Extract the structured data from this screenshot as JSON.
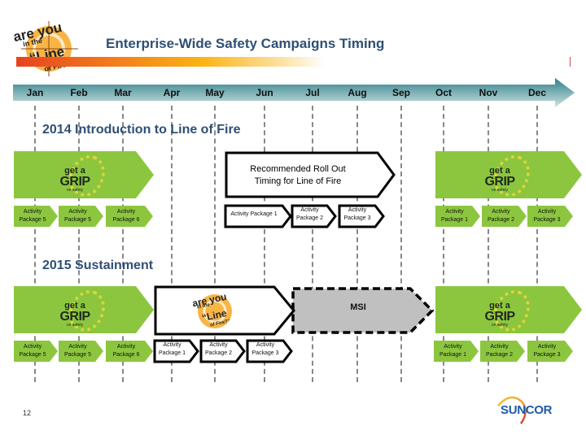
{
  "header": {
    "title": "Enterprise-Wide Safety Campaigns Timing",
    "logo_lines": [
      "are you",
      "in the",
      "“Line",
      "of Fire?”"
    ]
  },
  "timeline": {
    "months": [
      "Jan",
      "Feb",
      "Mar",
      "Apr",
      "May",
      "Jun",
      "Jul",
      "Aug",
      "Sep",
      "Oct",
      "Nov",
      "Dec"
    ]
  },
  "section_2014": {
    "title": "2014 Introduction to Line of Fire",
    "left_campaign": {
      "logo": {
        "line1": "get a",
        "line2": "GRIP",
        "line3": "on safety"
      },
      "packages": [
        {
          "line1": "Activity",
          "line2": "Package 5"
        },
        {
          "line1": "Activity",
          "line2": "Package 5"
        },
        {
          "line1": "Activity",
          "line2": "Package 6"
        }
      ]
    },
    "center_campaign": {
      "label_line1": "Recommended Roll Out",
      "label_line2": "Timing for Line of Fire",
      "packages": [
        {
          "line1": "Activity Package 1",
          "line2": ""
        },
        {
          "line1": "Activity",
          "line2": "Package 2"
        },
        {
          "line1": "Activity",
          "line2": "Package 3"
        }
      ]
    },
    "right_campaign": {
      "logo": {
        "line1": "get a",
        "line2": "GRIP",
        "line3": "on safety"
      },
      "packages": [
        {
          "line1": "Activity",
          "line2": "Package 1"
        },
        {
          "line1": "Activity",
          "line2": "Package 2"
        },
        {
          "line1": "Activity",
          "line2": "Package 3"
        }
      ]
    }
  },
  "section_2015": {
    "title": "2015 Sustainment",
    "left_campaign": {
      "logo": {
        "line1": "get a",
        "line2": "GRIP",
        "line3": "on safety"
      },
      "packages": [
        {
          "line1": "Activity",
          "line2": "Package 5"
        },
        {
          "line1": "Activity",
          "line2": "Package 5"
        },
        {
          "line1": "Activity",
          "line2": "Package 6"
        }
      ]
    },
    "center_campaign": {
      "logo_lines": [
        "are you",
        "in the",
        "“Line",
        "of Fire?”"
      ],
      "packages": [
        {
          "line1": "Activity",
          "line2": "Package 1"
        },
        {
          "line1": "Activity",
          "line2": "Package 2"
        },
        {
          "line1": "Activity",
          "line2": "Package 3"
        }
      ]
    },
    "msi": {
      "label": "MSI"
    },
    "right_campaign": {
      "logo": {
        "line1": "get a",
        "line2": "GRIP",
        "line3": "on safety"
      },
      "packages": [
        {
          "line1": "Activity",
          "line2": "Package 1"
        },
        {
          "line1": "Activity",
          "line2": "Package 2"
        },
        {
          "line1": "Activity",
          "line2": "Package 3"
        }
      ]
    }
  },
  "footer": {
    "page_number": "12",
    "brand": "SUNCOR"
  },
  "colors": {
    "title": "#2f4f75",
    "campaign_green": "#8cc63f",
    "timeline_teal": "#3a8b96",
    "msi_gray": "#c0c0c0",
    "brand_blue": "#1e5aa8"
  }
}
